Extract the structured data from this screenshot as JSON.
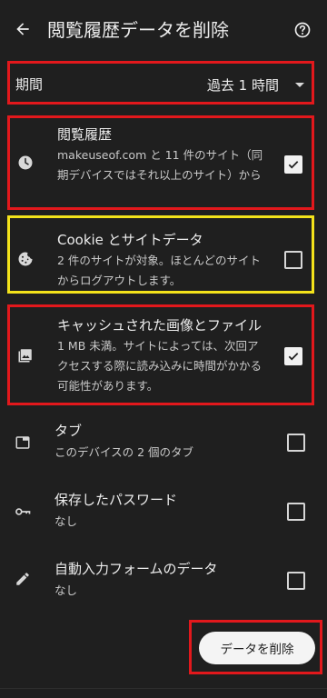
{
  "header": {
    "title": "閲覧履歴データを削除",
    "back_icon": "arrow-left-icon",
    "help_icon": "help-circle-icon"
  },
  "period": {
    "label": "期間",
    "value": "過去 1 時間"
  },
  "items": [
    {
      "icon": "clock-icon",
      "title": "閲覧履歴",
      "desc": "makeuseof.com と 11 件のサイト（同期デバイスではそれ以上のサイト）から",
      "checked": true
    },
    {
      "icon": "cookie-icon",
      "title": "Cookie とサイトデータ",
      "desc": "2 件のサイトが対象。ほとんどのサイトからログアウトします。",
      "checked": false
    },
    {
      "icon": "image-icon",
      "title": "キャッシュされた画像とファイル",
      "desc": "1 MB 未満。サイトによっては、次回アクセスする際に読み込みに時間がかかる可能性があります。",
      "checked": true
    },
    {
      "icon": "tab-icon",
      "title": "タブ",
      "desc": "このデバイスの 2 個のタブ",
      "checked": false
    },
    {
      "icon": "key-icon",
      "title": "保存したパスワード",
      "desc": "なし",
      "checked": false
    },
    {
      "icon": "pencil-icon",
      "title": "自動入力フォームのデータ",
      "desc": "なし",
      "checked": false
    }
  ],
  "actions": {
    "delete_label": "データを削除"
  },
  "colors": {
    "background": "#1f1f1f",
    "highlight_red": "#e2181c",
    "highlight_yellow": "#f3e21b"
  }
}
